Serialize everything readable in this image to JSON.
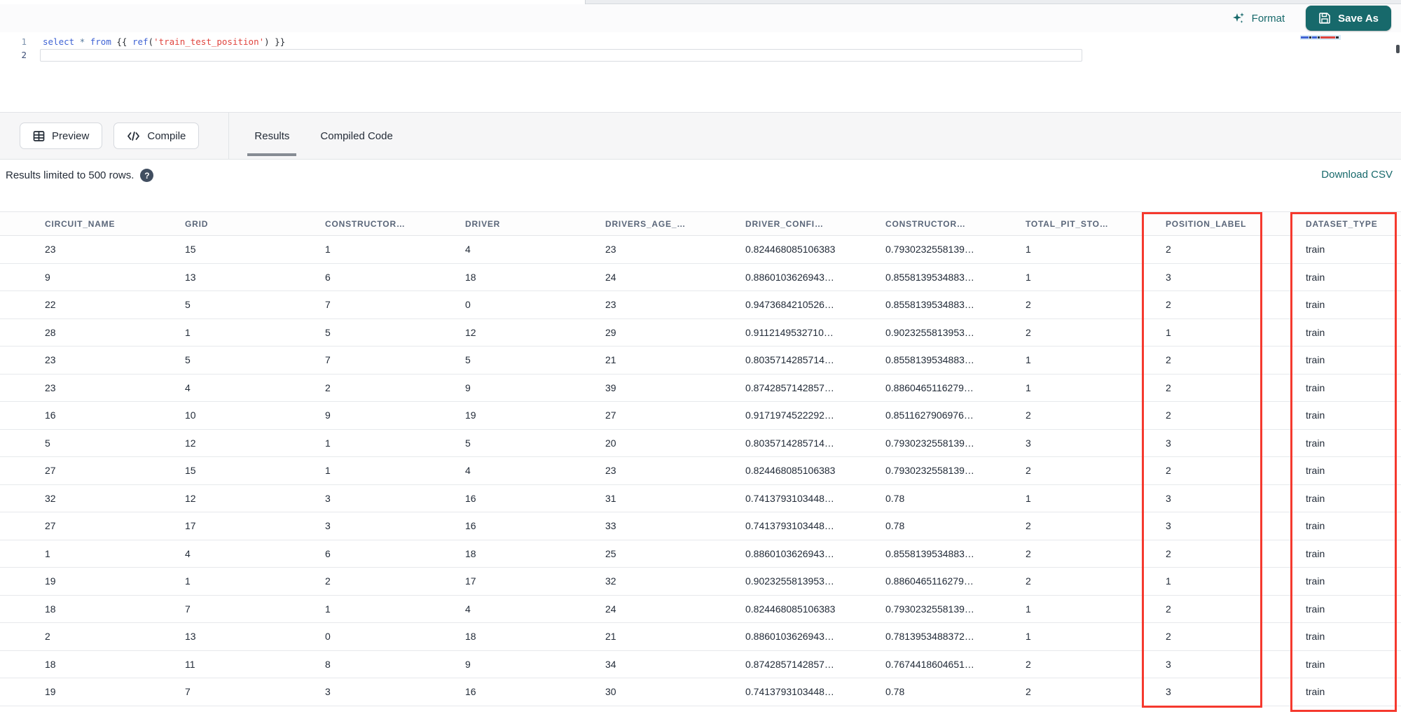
{
  "editor": {
    "toolbar": {
      "format_label": "Format",
      "save_as_label": "Save As"
    },
    "line_numbers": [
      "1",
      "2"
    ],
    "code_tokens": [
      {
        "text": "select",
        "type": "keyword"
      },
      {
        "text": " ",
        "type": "punct"
      },
      {
        "text": "*",
        "type": "operator"
      },
      {
        "text": " ",
        "type": "punct"
      },
      {
        "text": "from",
        "type": "keyword"
      },
      {
        "text": " {{ ",
        "type": "punct"
      },
      {
        "text": "ref",
        "type": "function"
      },
      {
        "text": "(",
        "type": "punct"
      },
      {
        "text": "'train_test_position'",
        "type": "string"
      },
      {
        "text": ")",
        "type": "punct"
      },
      {
        "text": " }}",
        "type": "punct"
      }
    ]
  },
  "panel": {
    "preview_label": "Preview",
    "compile_label": "Compile",
    "tabs": [
      {
        "label": "Results",
        "active": true
      },
      {
        "label": "Compiled Code",
        "active": false
      }
    ],
    "limit_note": "Results limited to 500 rows.",
    "help_glyph": "?",
    "download_csv_label": "Download CSV"
  },
  "table": {
    "columns": [
      "CIRCUIT_NAME",
      "GRID",
      "CONSTRUCTOR…",
      "DRIVER",
      "DRIVERS_AGE_…",
      "DRIVER_CONFI…",
      "CONSTRUCTOR…",
      "TOTAL_PIT_STO…",
      "POSITION_LABEL",
      "DATASET_TYPE"
    ],
    "highlighted_columns": [
      "POSITION_LABEL",
      "DATASET_TYPE"
    ],
    "rows": [
      [
        "23",
        "15",
        "1",
        "4",
        "23",
        "0.824468085106383",
        "0.7930232558139…",
        "1",
        "2",
        "train"
      ],
      [
        "9",
        "13",
        "6",
        "18",
        "24",
        "0.8860103626943…",
        "0.8558139534883…",
        "1",
        "3",
        "train"
      ],
      [
        "22",
        "5",
        "7",
        "0",
        "23",
        "0.9473684210526…",
        "0.8558139534883…",
        "2",
        "2",
        "train"
      ],
      [
        "28",
        "1",
        "5",
        "12",
        "29",
        "0.9112149532710…",
        "0.9023255813953…",
        "2",
        "1",
        "train"
      ],
      [
        "23",
        "5",
        "7",
        "5",
        "21",
        "0.8035714285714…",
        "0.8558139534883…",
        "1",
        "2",
        "train"
      ],
      [
        "23",
        "4",
        "2",
        "9",
        "39",
        "0.8742857142857…",
        "0.8860465116279…",
        "1",
        "2",
        "train"
      ],
      [
        "16",
        "10",
        "9",
        "19",
        "27",
        "0.9171974522292…",
        "0.8511627906976…",
        "2",
        "2",
        "train"
      ],
      [
        "5",
        "12",
        "1",
        "5",
        "20",
        "0.8035714285714…",
        "0.7930232558139…",
        "3",
        "3",
        "train"
      ],
      [
        "27",
        "15",
        "1",
        "4",
        "23",
        "0.824468085106383",
        "0.7930232558139…",
        "2",
        "2",
        "train"
      ],
      [
        "32",
        "12",
        "3",
        "16",
        "31",
        "0.7413793103448…",
        "0.78",
        "1",
        "3",
        "train"
      ],
      [
        "27",
        "17",
        "3",
        "16",
        "33",
        "0.7413793103448…",
        "0.78",
        "2",
        "3",
        "train"
      ],
      [
        "1",
        "4",
        "6",
        "18",
        "25",
        "0.8860103626943…",
        "0.8558139534883…",
        "2",
        "2",
        "train"
      ],
      [
        "19",
        "1",
        "2",
        "17",
        "32",
        "0.9023255813953…",
        "0.8860465116279…",
        "2",
        "1",
        "train"
      ],
      [
        "18",
        "7",
        "1",
        "4",
        "24",
        "0.824468085106383",
        "0.7930232558139…",
        "1",
        "2",
        "train"
      ],
      [
        "2",
        "13",
        "0",
        "18",
        "21",
        "0.8860103626943…",
        "0.7813953488372…",
        "1",
        "2",
        "train"
      ],
      [
        "18",
        "11",
        "8",
        "9",
        "34",
        "0.8742857142857…",
        "0.7674418604651…",
        "2",
        "3",
        "train"
      ],
      [
        "19",
        "7",
        "3",
        "16",
        "30",
        "0.7413793103448…",
        "0.78",
        "2",
        "3",
        "train"
      ]
    ]
  },
  "colors": {
    "accent_teal": "#17696b",
    "highlight_red": "#f5392e",
    "keyword_blue": "#3f63d4",
    "string_red": "#e0443e"
  }
}
